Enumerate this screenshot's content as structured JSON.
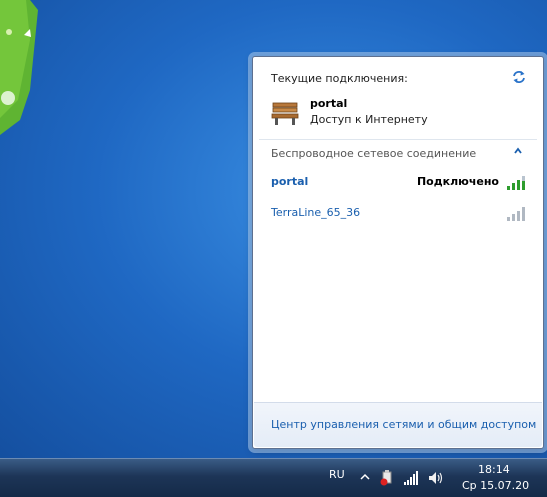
{
  "flyout": {
    "current_title": "Текущие подключения:",
    "connection_name": "portal",
    "connection_status": "Доступ к Интернету",
    "wireless_header": "Беспроводное сетевое соединение",
    "networks": [
      {
        "name": "portal",
        "status": "Подключено",
        "connected": true,
        "signal_bars": 4
      },
      {
        "name": "TerraLine_65_36",
        "status": "",
        "connected": false,
        "signal_bars": 0
      }
    ],
    "footer_link": "Центр управления сетями и общим доступом"
  },
  "taskbar": {
    "language": "RU",
    "time": "18:14",
    "date": "Ср 15.07.20"
  },
  "icons": {
    "refresh": "refresh-icon",
    "connection": "bench-network-icon",
    "collapse": "chevron-up-icon",
    "signal": "wifi-signal-icon",
    "safely_remove": "safely-remove-hardware-icon",
    "network_tray": "network-tray-icon",
    "volume": "speaker-icon"
  },
  "colors": {
    "link": "#1a5fae",
    "desktop": "#1f68c3",
    "taskbar": "#1d3557",
    "signal_active": "#2e9d2e"
  }
}
